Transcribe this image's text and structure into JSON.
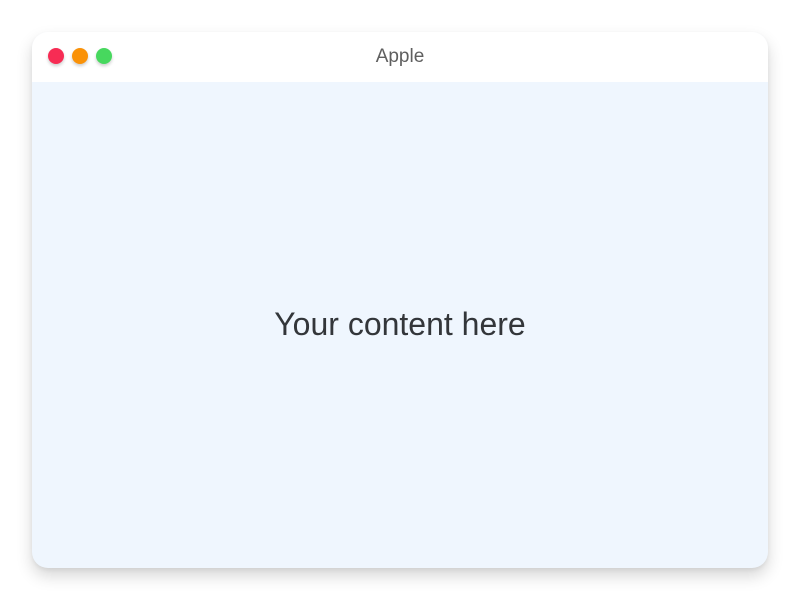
{
  "window": {
    "title": "Apple",
    "controls": [
      {
        "name": "close",
        "color": "#f72c54",
        "icon": "close-dot-icon"
      },
      {
        "name": "minimize",
        "color": "#fa9208",
        "icon": "minimize-dot-icon"
      },
      {
        "name": "zoom",
        "color": "#47d85e",
        "icon": "zoom-dot-icon"
      }
    ],
    "background": "#eff6fe",
    "titlebar_background": "#ffffff"
  },
  "content": {
    "text": "Your content here"
  }
}
